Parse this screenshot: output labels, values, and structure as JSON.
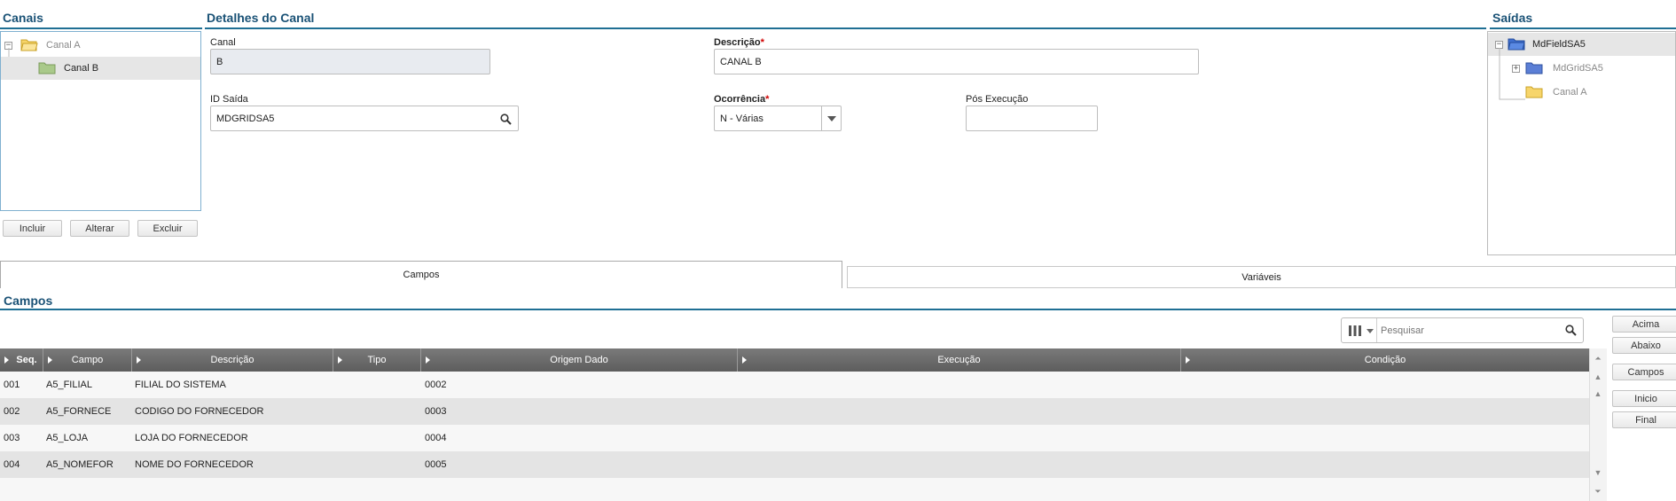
{
  "canais": {
    "title": "Canais",
    "tree": [
      {
        "label": "Canal A",
        "toggle": "−"
      },
      {
        "label": "Canal B"
      }
    ],
    "buttons": {
      "incluir": "Incluir",
      "alterar": "Alterar",
      "excluir": "Excluir"
    }
  },
  "detalhes": {
    "title": "Detalhes do Canal",
    "canal": {
      "label": "Canal",
      "value": "B"
    },
    "descricao": {
      "label": "Descrição",
      "required": "*",
      "value": "CANAL B"
    },
    "id_saida": {
      "label": "ID Saída",
      "value": "MDGRIDSA5"
    },
    "ocorrencia": {
      "label": "Ocorrência",
      "required": "*",
      "value": "N - Várias"
    },
    "pos_execucao": {
      "label": "Pós Execução",
      "value": ""
    }
  },
  "saidas": {
    "title": "Saídas",
    "tree": [
      {
        "label": "MdFieldSA5",
        "toggle": "−"
      },
      {
        "label": "MdGridSA5",
        "toggle": "+"
      },
      {
        "label": "Canal A"
      }
    ]
  },
  "tabs": {
    "campos": "Campos",
    "variaveis": "Variáveis"
  },
  "campos": {
    "title": "Campos",
    "search": {
      "placeholder": "Pesquisar"
    },
    "columns": [
      "Seq.",
      "Campo",
      "Descrição",
      "Tipo",
      "Origem Dado",
      "Execução",
      "Condição"
    ],
    "rows": [
      {
        "seq": "001",
        "campo": "A5_FILIAL",
        "descricao": "FILIAL DO SISTEMA",
        "tipo": "",
        "origem": "0002",
        "execucao": "",
        "condicao": ""
      },
      {
        "seq": "002",
        "campo": "A5_FORNECE",
        "descricao": "CODIGO DO FORNECEDOR",
        "tipo": "",
        "origem": "0003",
        "execucao": "",
        "condicao": ""
      },
      {
        "seq": "003",
        "campo": "A5_LOJA",
        "descricao": "LOJA DO FORNECEDOR",
        "tipo": "",
        "origem": "0004",
        "execucao": "",
        "condicao": ""
      },
      {
        "seq": "004",
        "campo": "A5_NOMEFOR",
        "descricao": "NOME DO FORNECEDOR",
        "tipo": "",
        "origem": "0005",
        "execucao": "",
        "condicao": ""
      }
    ],
    "side_buttons": {
      "acima": "Acima",
      "abaixo": "Abaixo",
      "campos": "Campos",
      "inicio": "Inicio",
      "final": "Final"
    }
  },
  "colors": {
    "section_title": "#1a5276",
    "accent_line": "#1f6f94",
    "grid_header": "#6b6b6b",
    "required": "#d00000"
  }
}
